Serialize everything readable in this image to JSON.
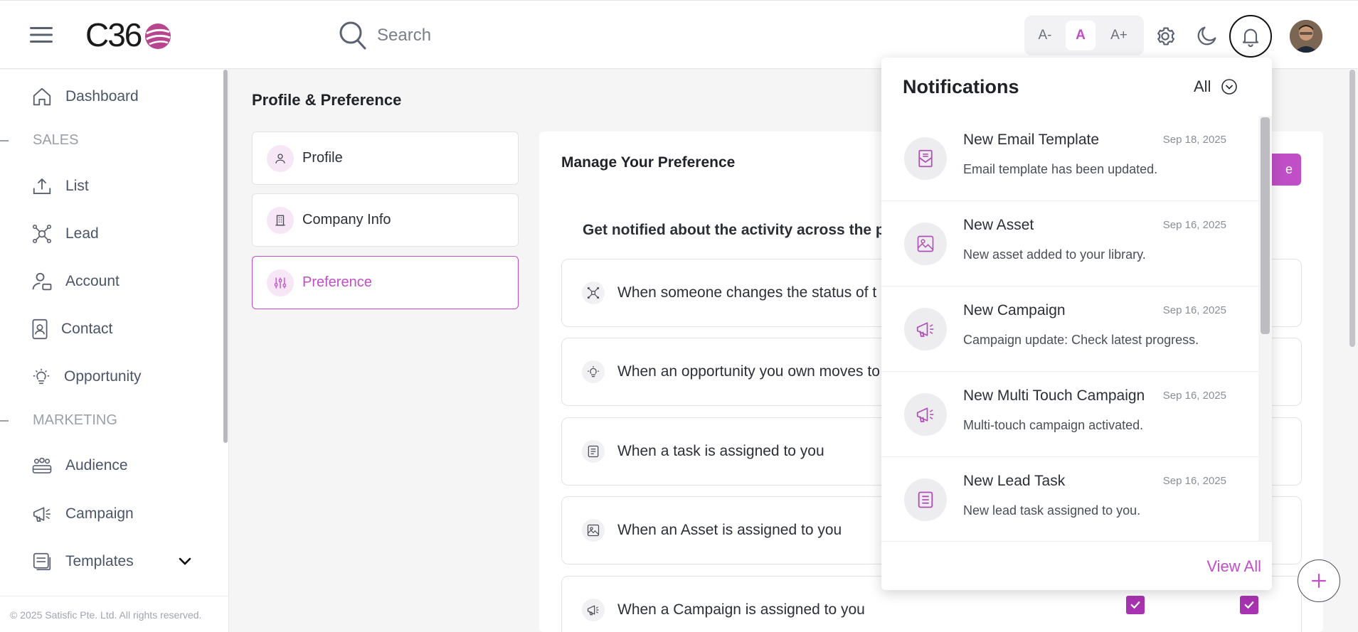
{
  "header": {
    "logo_text": "C36",
    "search_placeholder": "Search",
    "font_sizes": [
      "A-",
      "A",
      "A+"
    ],
    "active_font_size": "A"
  },
  "sidebar": {
    "items": [
      {
        "label": "Dashboard",
        "icon": "home-icon"
      },
      {
        "section": "SALES"
      },
      {
        "label": "List",
        "icon": "upload-icon"
      },
      {
        "label": "Lead",
        "icon": "lead-network-icon"
      },
      {
        "label": "Account",
        "icon": "account-user-icon"
      },
      {
        "label": "Contact",
        "icon": "contact-card-icon"
      },
      {
        "label": "Opportunity",
        "icon": "lightbulb-icon"
      },
      {
        "section": "MARKETING"
      },
      {
        "label": "Audience",
        "icon": "audience-group-icon"
      },
      {
        "label": "Campaign",
        "icon": "megaphone-icon"
      },
      {
        "label": "Templates",
        "icon": "templates-icon"
      }
    ],
    "copyright": "© 2025 Satisfic Pte. Ltd. All rights reserved."
  },
  "page": {
    "title": "Profile & Preference",
    "menu": [
      {
        "label": "Profile",
        "icon": "user-icon"
      },
      {
        "label": "Company Info",
        "icon": "building-icon"
      },
      {
        "label": "Preference",
        "icon": "sliders-icon",
        "active": true
      }
    ]
  },
  "preference": {
    "title": "Manage Your Preference",
    "save_label": "e",
    "subtitle": "Get notified about the activity across the platf",
    "rows": [
      {
        "label": "When someone changes the status of t",
        "icon": "network-icon"
      },
      {
        "label": "When an opportunity you own moves to",
        "icon": "lightbulb-icon"
      },
      {
        "label": "When a task is assigned to you",
        "icon": "task-list-icon"
      },
      {
        "label": "When an Asset is assigned to you",
        "icon": "image-icon"
      },
      {
        "label": "When a Campaign is assigned to you",
        "icon": "megaphone-icon",
        "checked": [
          true,
          true
        ]
      }
    ]
  },
  "notifications": {
    "title": "Notifications",
    "filter": "All",
    "items": [
      {
        "title": "New Email Template",
        "date": "Sep 18, 2025",
        "message": "Email template has been updated.",
        "icon": "email-template-icon"
      },
      {
        "title": "New Asset",
        "date": "Sep 16, 2025",
        "message": "New asset added to your library.",
        "icon": "image-icon"
      },
      {
        "title": "New Campaign",
        "date": "Sep 16, 2025",
        "message": "Campaign update: Check latest progress.",
        "icon": "megaphone-icon"
      },
      {
        "title": "New Multi Touch Campaign",
        "date": "Sep 16, 2025",
        "message": "Multi-touch campaign activated.",
        "icon": "megaphone-icon"
      },
      {
        "title": "New Lead Task",
        "date": "Sep 16, 2025",
        "message": "New lead task assigned to you.",
        "icon": "document-icon"
      }
    ],
    "view_all": "View All"
  },
  "colors": {
    "accent": "#c04ec6",
    "checkbox": "#a733b0"
  }
}
